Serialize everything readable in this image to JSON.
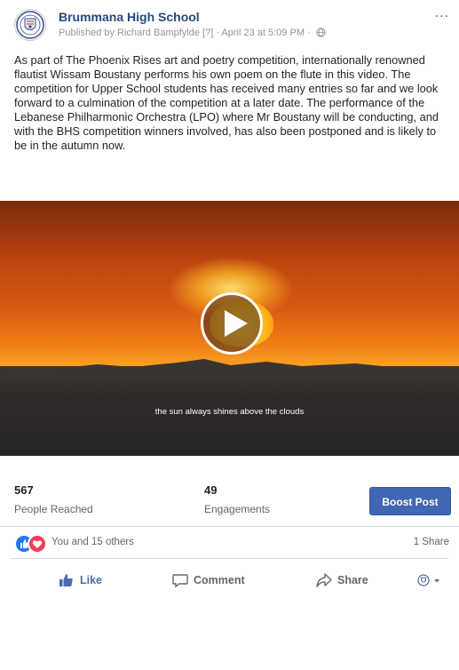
{
  "post": {
    "page_name": "Brummana High School",
    "meta": "Published by Richard Bampfylde [?] · April 23 at 5:09 PM ·",
    "more_label": "...",
    "text": "As part of The Phoenix Rises art and poetry competition, internationally renowned flautist Wissam Boustany performs his own poem on the flute in this video. The competition for Upper School students has received many entries so far and we look forward to a culmination of the competition at a later date. The performance of the Lebanese Philharmonic Orchestra (LPO) where Mr Boustany will be conducting, and with the BHS competition winners involved, has also been postponed and is likely to be in the autumn now."
  },
  "video": {
    "caption": "the sun always shines above the clouds"
  },
  "stats": {
    "reached_value": "567",
    "reached_label": "People Reached",
    "engagements_value": "49",
    "engagements_label": "Engagements",
    "boost_label": "Boost Post"
  },
  "reactions": {
    "text": "You and 15 others",
    "shares": "1 Share"
  },
  "actions": {
    "like": "Like",
    "comment": "Comment",
    "share": "Share"
  },
  "colors": {
    "brand_blue": "#4267b2",
    "link_blue": "#29487d",
    "like_blue": "#2078f4",
    "love_red": "#f33e58"
  },
  "icons": {
    "globe": "globe-icon",
    "like": "thumbs-up-icon",
    "comment": "comment-icon",
    "share": "share-arrow-icon",
    "crest": "school-crest-icon",
    "play": "play-icon"
  }
}
